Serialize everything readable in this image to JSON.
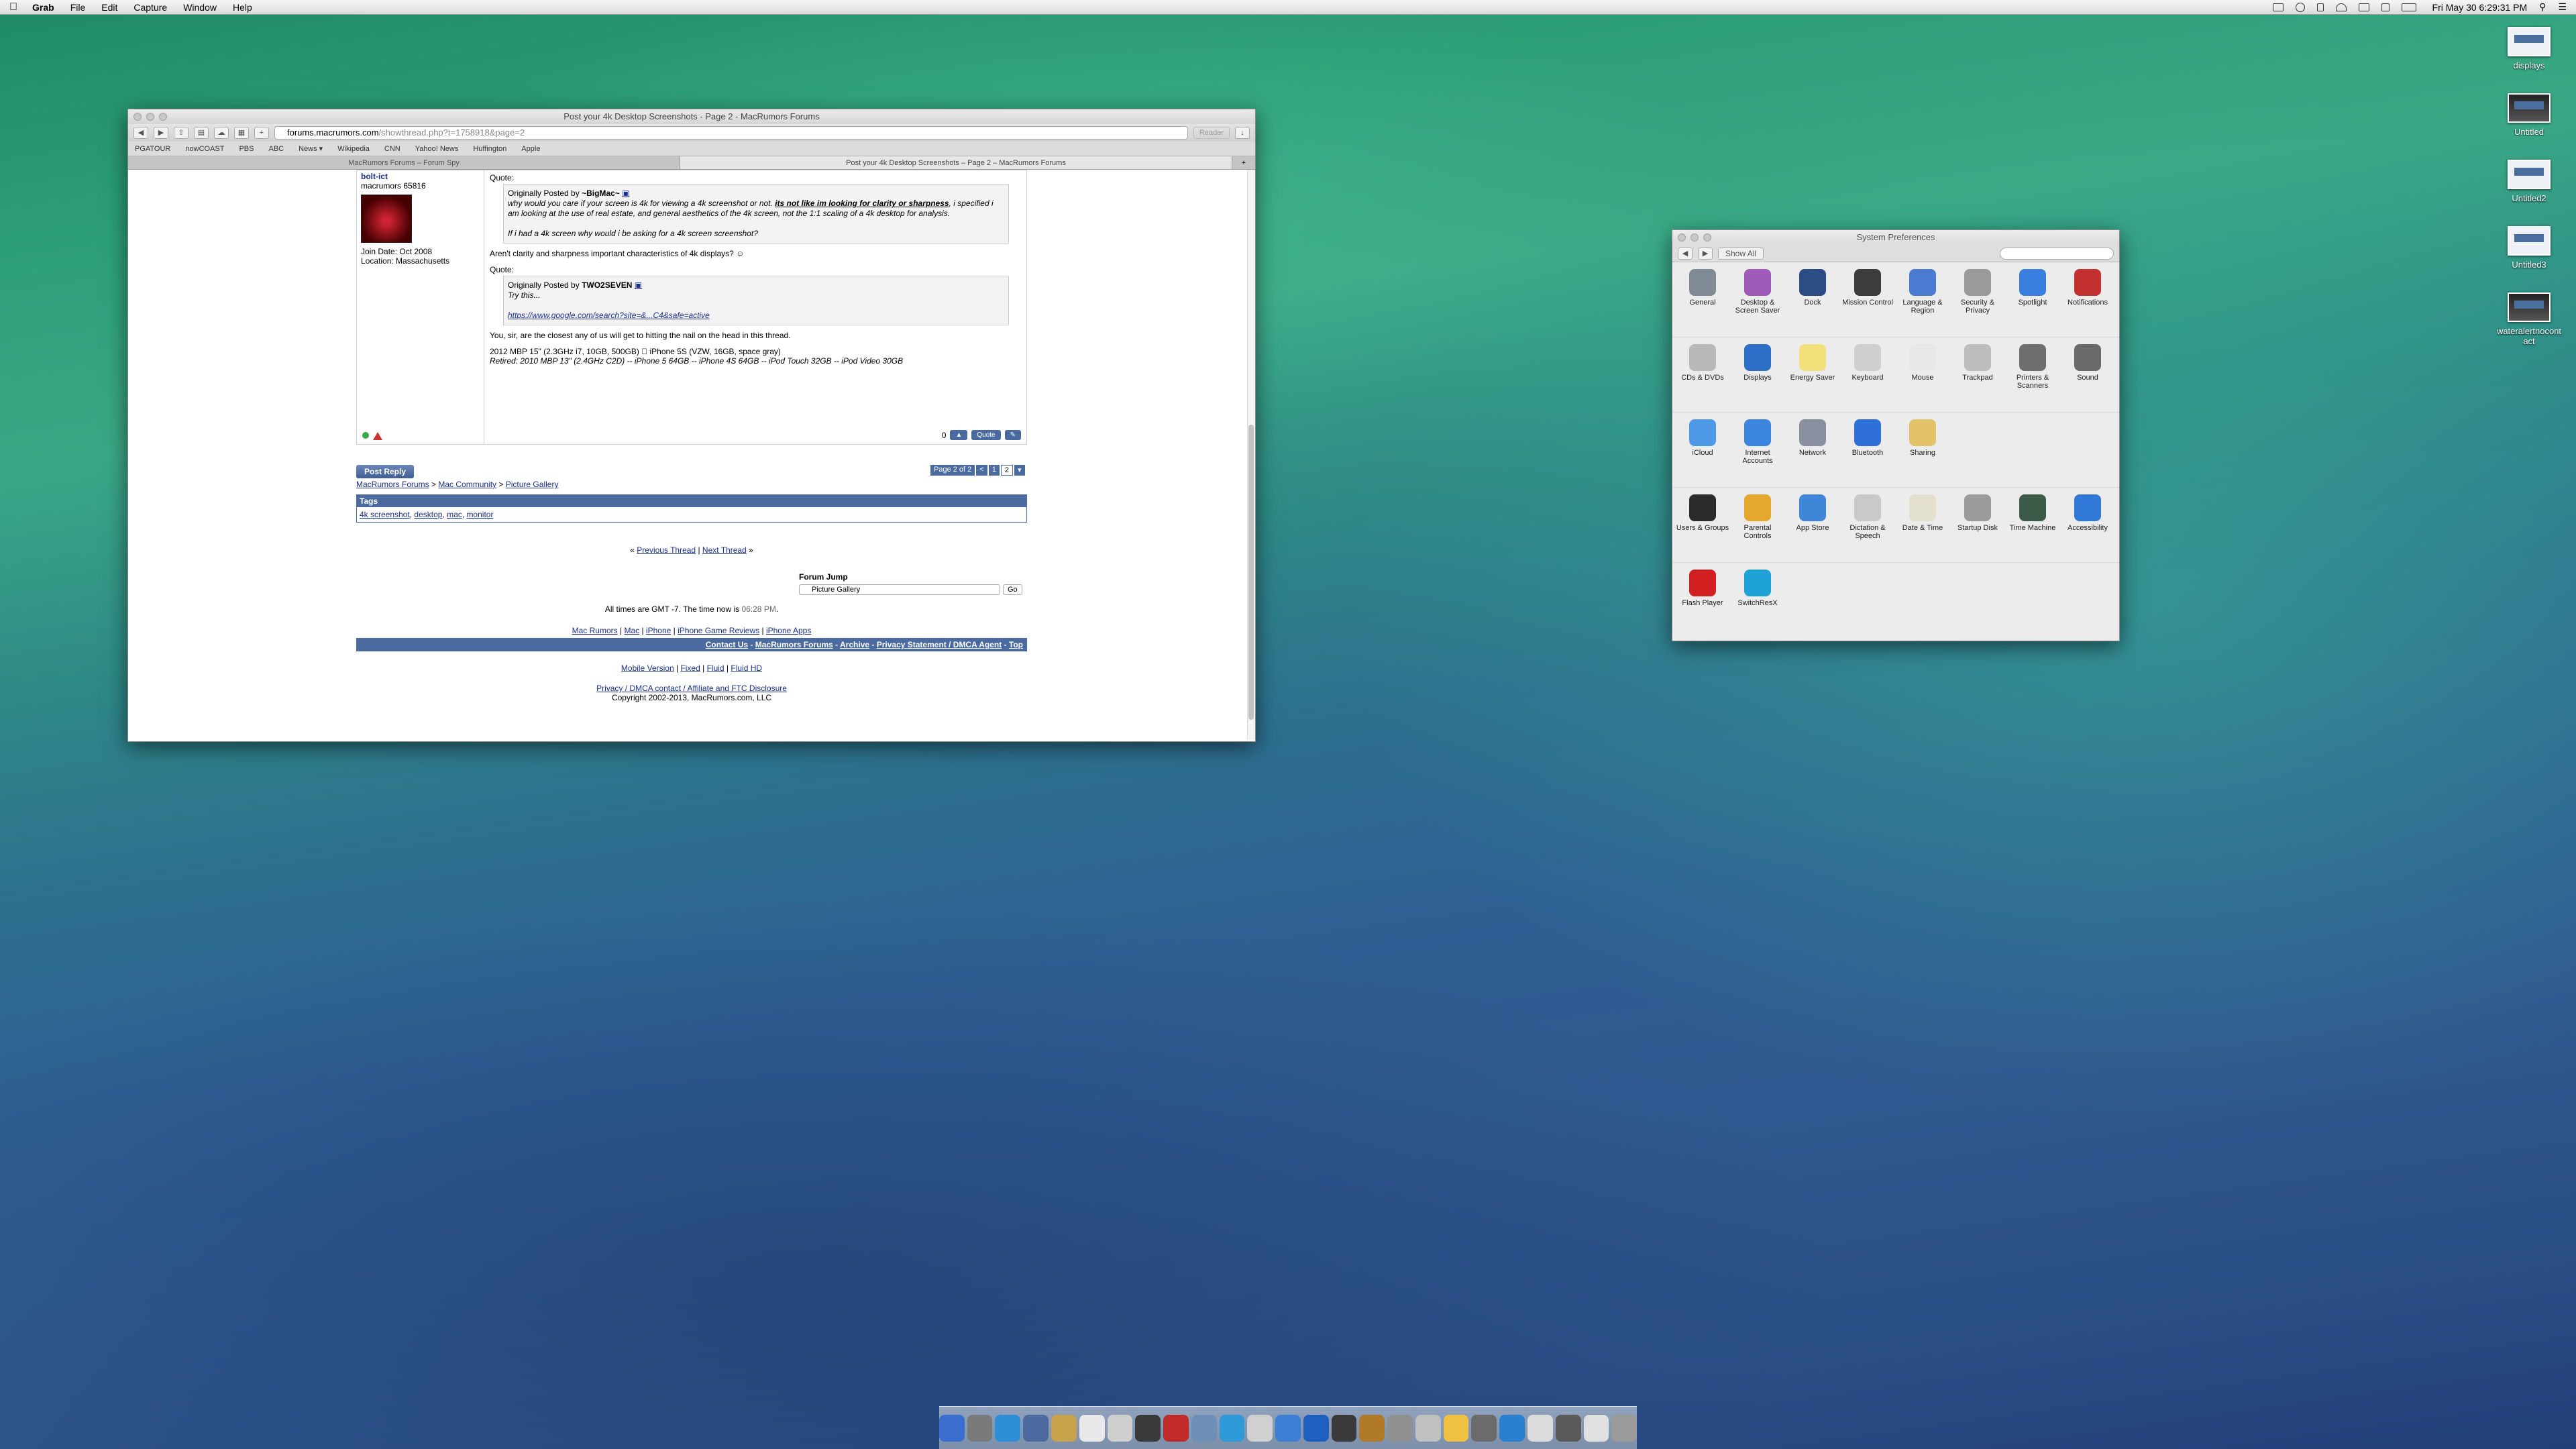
{
  "menubar": {
    "app": "Grab",
    "menus": [
      "File",
      "Edit",
      "Capture",
      "Window",
      "Help"
    ],
    "clock": "Fri May 30  6:29:31 PM"
  },
  "desktop_icons": [
    {
      "label": "displays"
    },
    {
      "label": "Untitled"
    },
    {
      "label": "Untitled2"
    },
    {
      "label": "Untitled3"
    },
    {
      "label": "wateralertnocontact"
    }
  ],
  "safari": {
    "title": "Post your 4k Desktop Screenshots - Page 2 - MacRumors Forums",
    "url_host": "forums.macrumors.com",
    "url_path": "/showthread.php?t=1758918&page=2",
    "reader": "Reader",
    "bookmarks": [
      "PGATOUR",
      "nowCOAST",
      "PBS",
      "ABC",
      "News ▾",
      "Wikipedia",
      "CNN",
      "Yahoo! News",
      "Huffington",
      "Apple"
    ],
    "tabs": [
      "MacRumors Forums – Forum Spy",
      "Post your 4k Desktop Screenshots – Page 2 – MacRumors Forums"
    ]
  },
  "post": {
    "username": "bolt-ict",
    "rank": "macrumors 65816",
    "join_date": "Join Date: Oct 2008",
    "location": "Location: Massachusetts",
    "quote_label": "Quote:",
    "q1_author_prefix": "Originally Posted by ",
    "q1_author": "~BigMac~",
    "q1_text_a": "why would you care if your screen is 4k for viewing a 4k screenshot or not. ",
    "q1_text_b": "its not like im looking for clarity or sharpness",
    "q1_text_c": ", i specified i am looking at the use of real estate, and general aesthetics of the 4k screen, not the 1:1 scaling of a 4k desktop for analysis.",
    "q1_text_d": "If i had a 4k screen why would i be asking for a 4k screen screenshot?",
    "reply1": "Aren't clarity and sharpness important characteristics of 4k displays? ☺",
    "q2_author_prefix": "Originally Posted by ",
    "q2_author": "TWO2SEVEN",
    "q2_text": "Try this...",
    "q2_link": "https://www.google.com/search?site=&...C4&safe=active",
    "reply2": "You, sir, are the closest any of us will get to hitting the nail on the head in this thread.",
    "sig1": "2012 MBP 15\" (2.3GHz i7, 10GB, 500GB)  iPhone 5S (VZW, 16GB, space gray)",
    "sig2": "Retired: 2010 MBP 13\" (2.4GHz C2D) -- iPhone 5 64GB -- iPhone 4S 64GB -- iPod Touch 32GB -- iPod Video 30GB",
    "likes": "0",
    "quote_btn": "Quote"
  },
  "forum": {
    "post_reply": "Post Reply",
    "pager": [
      "Page 2 of 2",
      "<",
      "1",
      "2",
      "▾"
    ],
    "crumbs": [
      "MacRumors Forums",
      "Mac Community",
      "Picture Gallery"
    ],
    "tags_title": "Tags",
    "tags": [
      "4k screenshot",
      "desktop",
      "mac",
      "monitor"
    ],
    "prev_thread": "Previous Thread",
    "next_thread": "Next Thread",
    "forum_jump": "Forum Jump",
    "forum_jump_value": "Picture Gallery",
    "go": "Go",
    "times": "All times are GMT -7. The time now is ",
    "time_now": "06:28 PM",
    "footer_links": [
      "Mac Rumors",
      "Mac",
      "iPhone",
      "iPhone Game Reviews",
      "iPhone Apps"
    ],
    "footer_bar": [
      "Contact Us",
      "MacRumors Forums",
      "Archive",
      "Privacy Statement / DMCA Agent",
      "Top"
    ],
    "mobile_links": [
      "Mobile Version",
      "Fixed",
      "Fluid",
      "Fluid HD"
    ],
    "privacy": "Privacy / DMCA contact / Affiliate and FTC Disclosure",
    "copyright": "Copyright 2002-2013, MacRumors.com, LLC"
  },
  "syspref": {
    "title": "System Preferences",
    "show_all": "Show All",
    "rows": [
      [
        {
          "label": "General",
          "icon": "general-icon",
          "color": "#7f8a95"
        },
        {
          "label": "Desktop & Screen Saver",
          "icon": "desktop-icon",
          "color": "#a05ab8"
        },
        {
          "label": "Dock",
          "icon": "dock-icon",
          "color": "#2b4c85"
        },
        {
          "label": "Mission Control",
          "icon": "mission-control-icon",
          "color": "#3c3c3c"
        },
        {
          "label": "Language & Region",
          "icon": "flag-icon",
          "color": "#4a7bd0"
        },
        {
          "label": "Security & Privacy",
          "icon": "house-icon",
          "color": "#9a9a9a"
        },
        {
          "label": "Spotlight",
          "icon": "spotlight-icon",
          "color": "#3a7fe0"
        },
        {
          "label": "Notifications",
          "icon": "notifications-icon",
          "color": "#c23030"
        }
      ],
      [
        {
          "label": "CDs & DVDs",
          "icon": "cd-icon",
          "color": "#b8b8b8"
        },
        {
          "label": "Displays",
          "icon": "display-icon",
          "color": "#2e70c8"
        },
        {
          "label": "Energy Saver",
          "icon": "bulb-icon",
          "color": "#f2e07a"
        },
        {
          "label": "Keyboard",
          "icon": "keyboard-icon",
          "color": "#cfcfcf"
        },
        {
          "label": "Mouse",
          "icon": "mouse-icon",
          "color": "#e8e8e8"
        },
        {
          "label": "Trackpad",
          "icon": "trackpad-icon",
          "color": "#bdbdbd"
        },
        {
          "label": "Printers & Scanners",
          "icon": "printer-icon",
          "color": "#6f6f6f"
        },
        {
          "label": "Sound",
          "icon": "speaker-icon",
          "color": "#6a6a6a"
        }
      ],
      [
        {
          "label": "iCloud",
          "icon": "cloud-icon",
          "color": "#4f9ae6"
        },
        {
          "label": "Internet Accounts",
          "icon": "at-icon",
          "color": "#3d86e0"
        },
        {
          "label": "Network",
          "icon": "globe-icon",
          "color": "#8a8fa0"
        },
        {
          "label": "Bluetooth",
          "icon": "bluetooth-icon",
          "color": "#2e6fd8"
        },
        {
          "label": "Sharing",
          "icon": "folder-icon",
          "color": "#e2c36a"
        }
      ],
      [
        {
          "label": "Users & Groups",
          "icon": "users-icon",
          "color": "#2a2a2a"
        },
        {
          "label": "Parental Controls",
          "icon": "parental-icon",
          "color": "#e6a82c"
        },
        {
          "label": "App Store",
          "icon": "appstore-icon",
          "color": "#3f86d8"
        },
        {
          "label": "Dictation & Speech",
          "icon": "mic-icon",
          "color": "#c9c9c9"
        },
        {
          "label": "Date & Time",
          "icon": "clock-icon",
          "color": "#e4e0d0"
        },
        {
          "label": "Startup Disk",
          "icon": "disk-icon",
          "color": "#9b9b9b"
        },
        {
          "label": "Time Machine",
          "icon": "timemachine-icon",
          "color": "#3c5a48"
        },
        {
          "label": "Accessibility",
          "icon": "accessibility-icon",
          "color": "#2f78d8"
        }
      ],
      [
        {
          "label": "Flash Player",
          "icon": "flash-icon",
          "color": "#d21f1f"
        },
        {
          "label": "SwitchResX",
          "icon": "monitor-icon",
          "color": "#1fa3d6"
        }
      ]
    ]
  },
  "dock": [
    "#3a6fd0",
    "#7a7a7a",
    "#2c8fd8",
    "#4c6aa0",
    "#c8a24a",
    "#e8e8e8",
    "#cfcfcf",
    "#3a3a3a",
    "#c02a2a",
    "#6e8fb8",
    "#2e9ad8",
    "#d0d0d0",
    "#3b7fd4",
    "#1f5fbf",
    "#3a3a3a",
    "#b07a2a",
    "#909090",
    "#c0c0c0",
    "#f0c040",
    "#6b6b6b",
    "#2a7fd0",
    "#dcdcdc",
    "#5a5a5a",
    "#e0e0e0",
    "#9a9a9a"
  ]
}
